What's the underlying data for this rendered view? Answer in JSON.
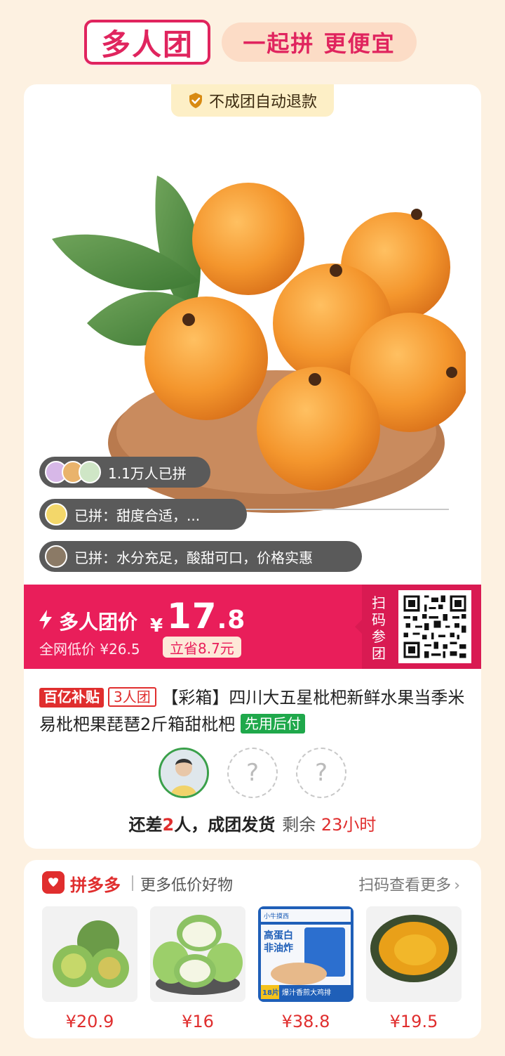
{
  "header": {
    "brand": "多人团",
    "slogan": "一起拼 更便宜"
  },
  "product": {
    "refund_badge": "不成团自动退款",
    "joined_count": "1.1万人已拼",
    "reviews": [
      "已拼：甜度合适，...",
      "已拼：水分充足，酸甜可口，价格实惠"
    ],
    "price": {
      "label": "多人团价",
      "currency": "¥",
      "integer": "17",
      "decimal": ".8",
      "market_price": "全网低价 ¥26.5",
      "save": "立省8.7元"
    },
    "scan_label": "扫码参团",
    "tags": {
      "subsidy": "百亿补贴",
      "group_size": "3人团",
      "pay_later": "先用后付"
    },
    "title": "【彩箱】四川大五星枇杷新鲜水果当季米易枇杷果琵琶2斤箱甜枇杷",
    "empty_slot": "?",
    "status": {
      "prefix": "还差",
      "count": "2",
      "suffix": "人，成团发货",
      "remaining_label": "剩余",
      "remaining_time": "23小时"
    }
  },
  "recommend": {
    "platform": "拼多多",
    "subtitle": "更多低价好物",
    "more": "扫码查看更多",
    "items": [
      {
        "price": "¥20.9"
      },
      {
        "price": "¥16"
      },
      {
        "price": "¥38.8",
        "packaging_text": [
          "小牛摸西",
          "高蛋白",
          "非油炸",
          "爆汁香煎大鸡排",
          "18片"
        ]
      },
      {
        "price": "¥19.5"
      }
    ]
  },
  "colors": {
    "brand_pink": "#e91e5a",
    "deal_red": "#e02e2e",
    "green": "#1fa84b",
    "page_bg": "#fdf1e1"
  }
}
